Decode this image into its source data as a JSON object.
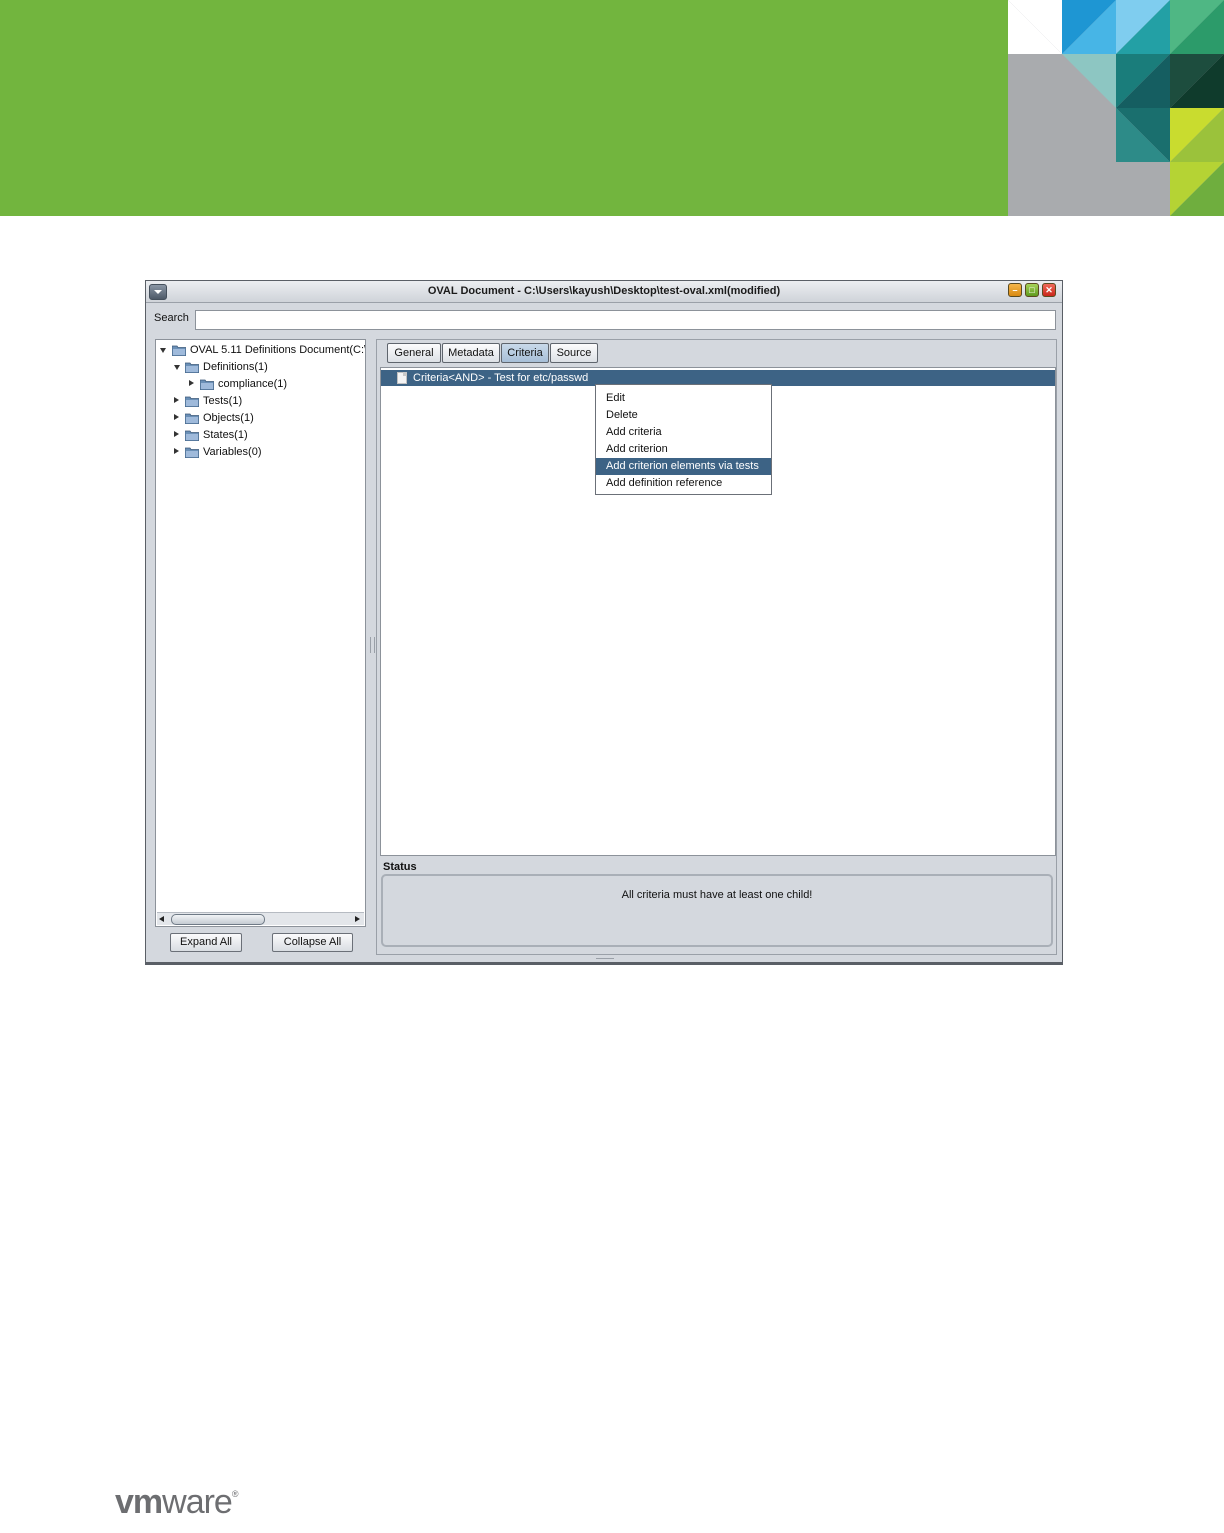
{
  "colors": {
    "banner_green": "#72b53e",
    "selection_blue": "#3d6385",
    "window_bg": "#d4d8de"
  },
  "window": {
    "title": "OVAL Document - C:\\Users\\kayush\\Desktop\\test-oval.xml(modified)",
    "controls": [
      "minimize-icon",
      "maximize-icon",
      "close-icon"
    ]
  },
  "search": {
    "label": "Search",
    "value": ""
  },
  "tree": {
    "root": "OVAL 5.11 Definitions Document(C:\\",
    "definitions": "Definitions(1)",
    "compliance": "compliance(1)",
    "tests": "Tests(1)",
    "objects": "Objects(1)",
    "states": "States(1)",
    "variables": "Variables(0)"
  },
  "buttons": {
    "expand_all": "Expand All",
    "collapse_all": "Collapse All"
  },
  "tabs": [
    {
      "label": "General"
    },
    {
      "label": "Metadata"
    },
    {
      "label": "Criteria",
      "active": true
    },
    {
      "label": "Source"
    }
  ],
  "criteria": {
    "row_label": "Criteria<AND> - Test for etc/passwd"
  },
  "context_menu": {
    "items": [
      {
        "label": "Edit"
      },
      {
        "label": "Delete"
      },
      {
        "label": "Add criteria"
      },
      {
        "label": "Add criterion"
      },
      {
        "label": "Add criterion elements via tests",
        "highlighted": true
      },
      {
        "label": "Add definition reference"
      }
    ]
  },
  "status": {
    "title": "Status",
    "message": "All criteria must have at least one child!"
  },
  "footer": {
    "logo_vm": "vm",
    "logo_ware": "ware",
    "logo_reg": "®"
  }
}
